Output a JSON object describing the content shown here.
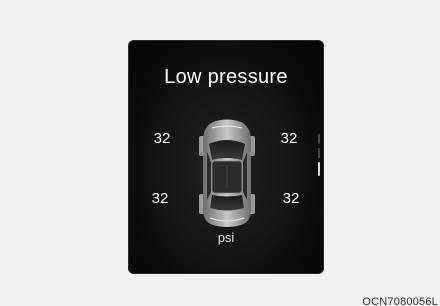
{
  "screen": {
    "title": "Low pressure",
    "tires": {
      "front_left": "32",
      "front_right": "32",
      "rear_left": "32",
      "rear_right": "32"
    },
    "unit": "psi",
    "icon": "car-topview-icon"
  },
  "caption": "OCN7080056L",
  "colors": {
    "page_background": "#f1f1f1",
    "screen_background": "#0c0c0c",
    "text": "#ffffff"
  }
}
